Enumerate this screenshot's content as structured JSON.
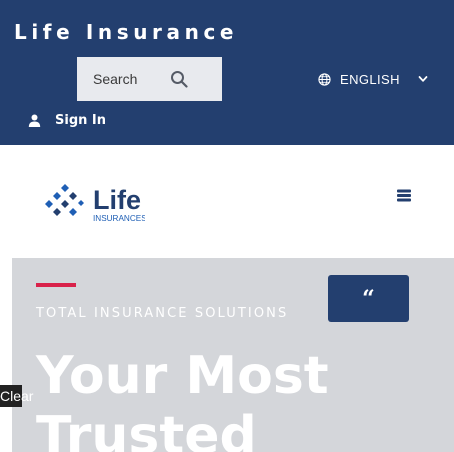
{
  "top_bar": {
    "site_title": "Life Insurance",
    "search": {
      "placeholder": "Search"
    },
    "language": {
      "label": "ENGLISH"
    },
    "sign_in": {
      "label": "Sign In"
    }
  },
  "header": {
    "logo": {
      "word": "Life",
      "subtext": "INSURANCES"
    }
  },
  "hero": {
    "tagline": "TOTAL INSURANCE SOLUTIONS",
    "quote_symbol": "“",
    "headline": "Your Most Trusted"
  },
  "clear_button": {
    "label": "Clear"
  },
  "colors": {
    "brand_navy": "#233f6f",
    "accent_red": "#d9224a",
    "hero_bg": "#d4d6da",
    "logo_blue": "#1f5fb5"
  }
}
